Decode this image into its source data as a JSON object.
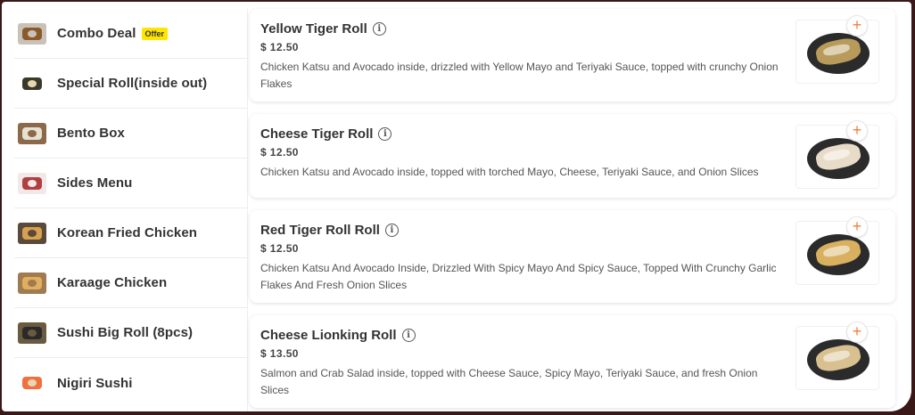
{
  "sidebar": {
    "items": [
      {
        "label": "Combo Deal",
        "badge": "Offer",
        "thumb_bg": "#c9c2b8",
        "thumb_fg": "#8a5a2a"
      },
      {
        "label": "Special Roll(inside out)",
        "thumb_bg": "#ffffff",
        "thumb_fg": "#3a3a2a"
      },
      {
        "label": "Bento Box",
        "thumb_bg": "#8a6a4a",
        "thumb_fg": "#e8e0d0"
      },
      {
        "label": "Sides Menu",
        "thumb_bg": "#f2e8e8",
        "thumb_fg": "#b04040"
      },
      {
        "label": "Korean Fried Chicken",
        "thumb_bg": "#5a4a3a",
        "thumb_fg": "#d9a050"
      },
      {
        "label": "Karaage Chicken",
        "thumb_bg": "#a07a50",
        "thumb_fg": "#e0b060"
      },
      {
        "label": "Sushi Big Roll (8pcs)",
        "thumb_bg": "#6a5a40",
        "thumb_fg": "#2a2a2a"
      },
      {
        "label": "Nigiri Sushi",
        "thumb_bg": "#ffffff",
        "thumb_fg": "#f07040"
      }
    ]
  },
  "menu": {
    "items": [
      {
        "name": "Yellow Tiger Roll",
        "price": "$ 12.50",
        "description": "Chicken Katsu and Avocado inside, drizzled with Yellow Mayo and Teriyaki Sauce, topped with crunchy Onion Flakes",
        "food_color": "#b89a5a"
      },
      {
        "name": "Cheese Tiger Roll",
        "price": "$ 12.50",
        "description": "Chicken Katsu and Avocado inside, topped with torched Mayo, Cheese, Teriyaki Sauce, and Onion Slices",
        "food_color": "#e8dcc8"
      },
      {
        "name": "Red Tiger Roll Roll",
        "price": "$ 12.50",
        "description": "Chicken Katsu And Avocado Inside, Drizzled With Spicy Mayo And Spicy Sauce, Topped With Crunchy Garlic Flakes And Fresh Onion Slices",
        "food_color": "#d8b060"
      },
      {
        "name": "Cheese Lionking Roll",
        "price": "$ 13.50",
        "description": "Salmon and Crab Salad inside, topped with Cheese Sauce, Spicy Mayo, Teriyaki Sauce, and fresh Onion Slices",
        "food_color": "#d8c090"
      }
    ],
    "add_icon": "plus-icon",
    "info_icon": "info-icon",
    "info_glyph": "i",
    "add_glyph": "+",
    "accent_color": "#f0803c"
  }
}
